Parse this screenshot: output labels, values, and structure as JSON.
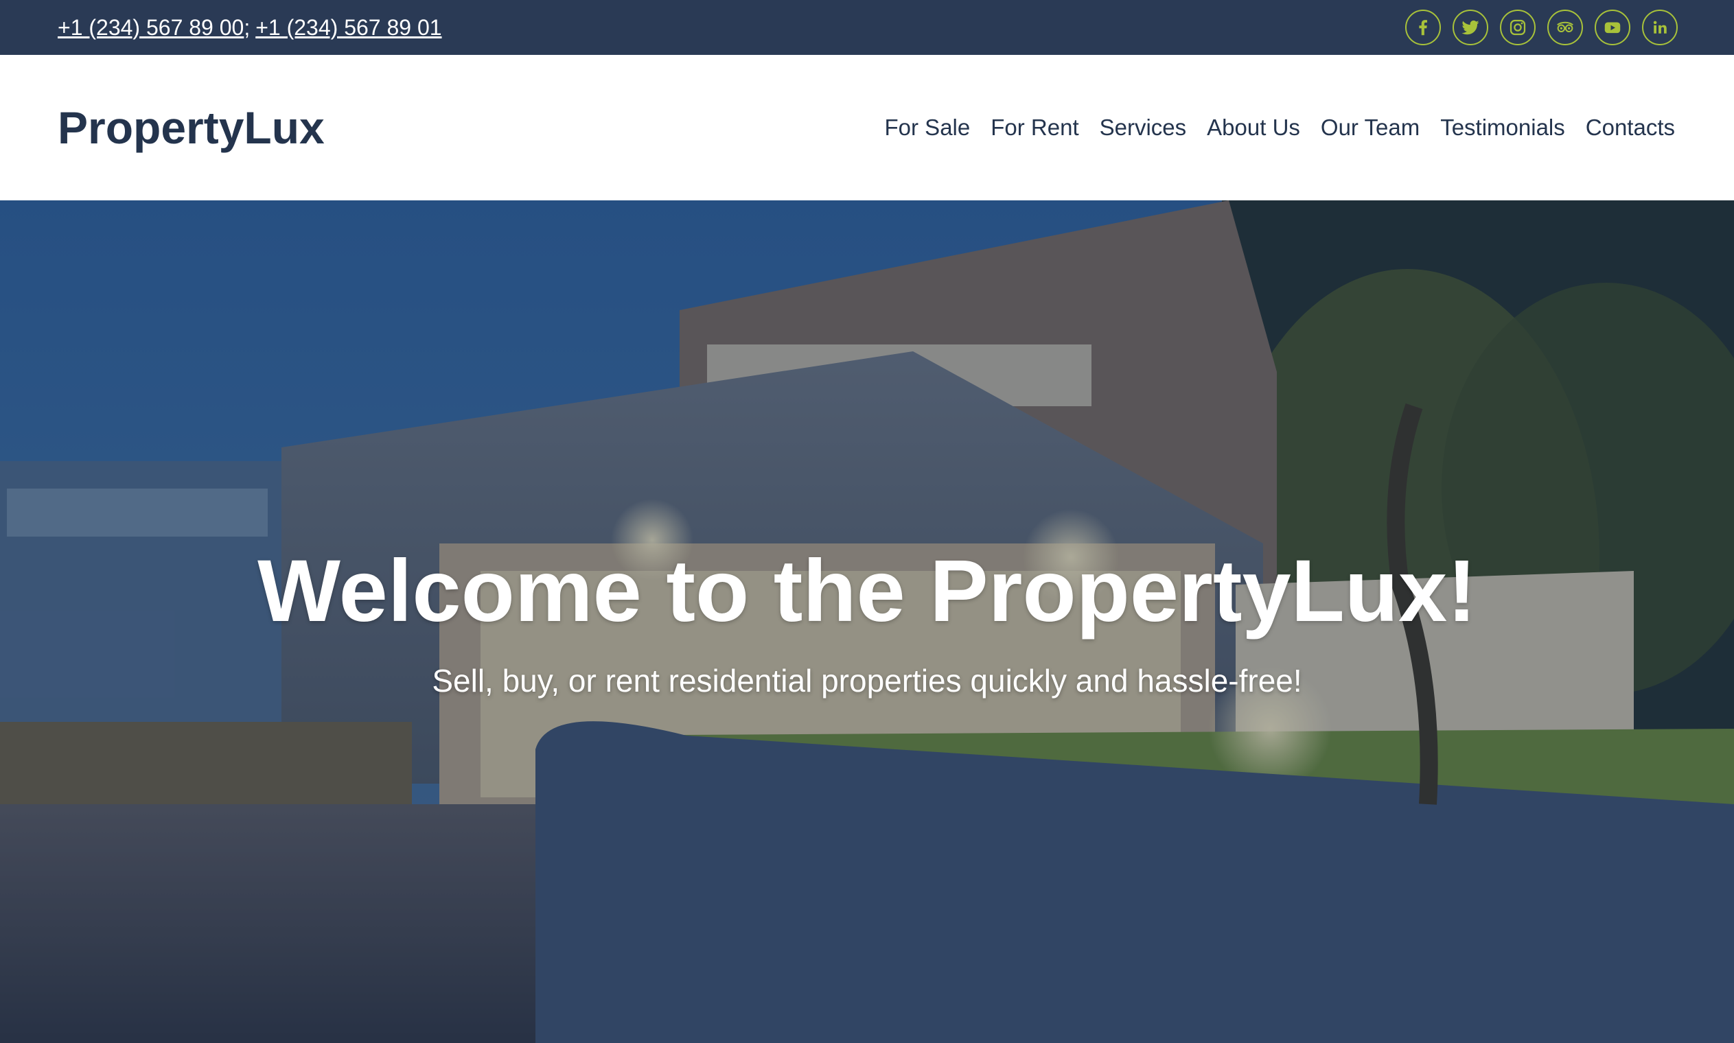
{
  "topbar": {
    "phone_1": "+1 (234) 567 89 00",
    "separator": ";",
    "phone_2": "+1 (234) 567 89 01",
    "socials": [
      {
        "icon": "facebook-icon"
      },
      {
        "icon": "twitter-icon"
      },
      {
        "icon": "instagram-icon"
      },
      {
        "icon": "tripadvisor-icon"
      },
      {
        "icon": "youtube-icon"
      },
      {
        "icon": "linkedin-icon"
      }
    ],
    "accent_color": "#a8c23a",
    "background_color": "#2a3a55"
  },
  "header": {
    "logo": "PropertyLux",
    "nav": {
      "for_sale": "For Sale",
      "for_rent": "For Rent",
      "services": "Services",
      "about_us": "About Us",
      "our_team": "Our Team",
      "testimonials": "Testimonials",
      "contacts": "Contacts"
    },
    "text_color": "#24344d"
  },
  "hero": {
    "title": "Welcome to the PropertyLux!",
    "subtitle": "Sell, buy, or rent residential properties quickly and hassle-free!"
  }
}
